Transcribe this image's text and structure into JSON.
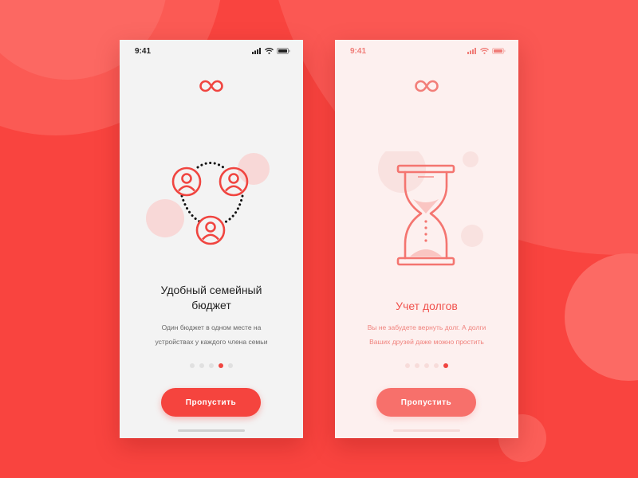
{
  "colors": {
    "background": "#f9443f",
    "accent": "#f5443e",
    "accent_light": "#f7706b",
    "screen1_bg": "#f3f3f3",
    "screen2_bg": "#fdf0ef"
  },
  "screens": [
    {
      "status_time": "9:41",
      "logo_icon": "infinity-logo-icon",
      "illustration_icon": "family-members-icon",
      "title_line1": "Удобный семейный",
      "title_line2": "бюджет",
      "desc_line1": "Один бюджет в одном месте на",
      "desc_line2": "устройствах у каждого члена семьи",
      "page_count": 5,
      "active_page": 4,
      "skip_label": "Пропустить"
    },
    {
      "status_time": "9:41",
      "logo_icon": "infinity-logo-icon",
      "illustration_icon": "hourglass-icon",
      "title_line1": "Учет долгов",
      "desc_line1": "Вы не забудете вернуть долг. А долги",
      "desc_line2": "Ваших друзей даже можно простить",
      "page_count": 5,
      "active_page": 5,
      "skip_label": "Пропустить"
    }
  ]
}
